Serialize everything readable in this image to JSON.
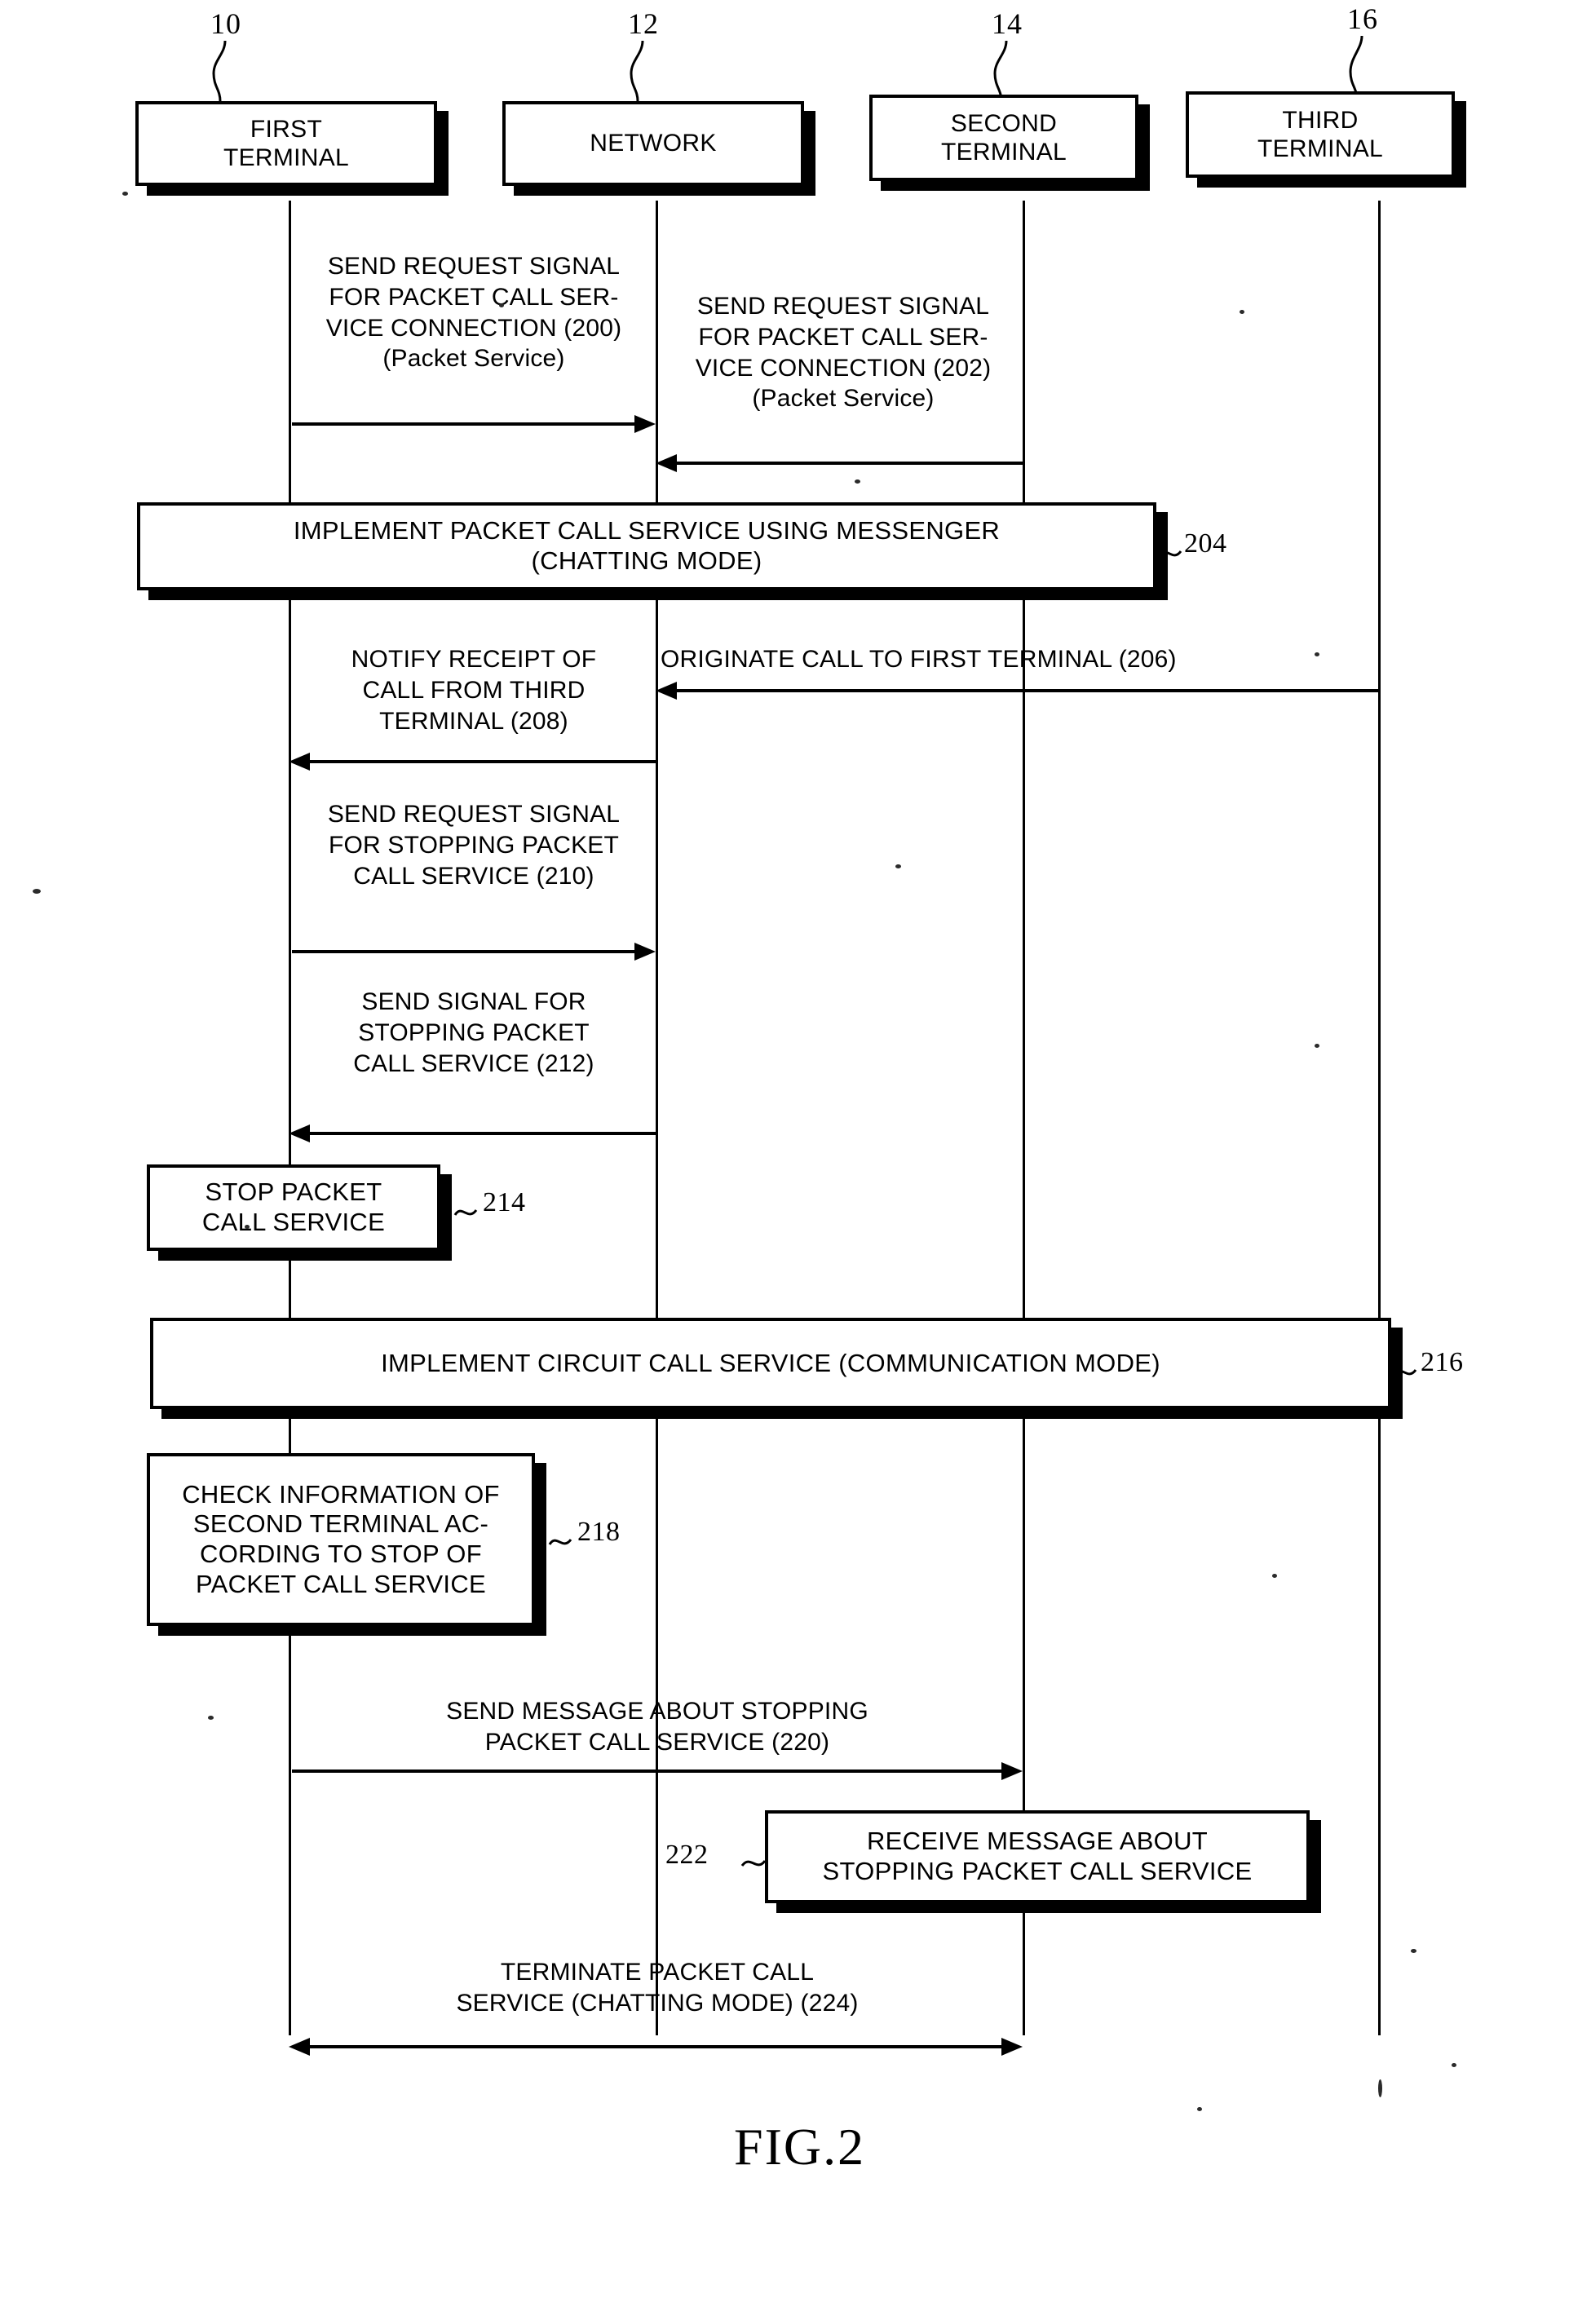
{
  "figure": {
    "caption": "FIG.2",
    "type": "sequence-diagram"
  },
  "participants": [
    {
      "ref": "10",
      "label_line1": "FIRST",
      "label_line2": "TERMINAL",
      "name": "first-terminal"
    },
    {
      "ref": "12",
      "label_line1": "NETWORK",
      "label_line2": "",
      "name": "network"
    },
    {
      "ref": "14",
      "label_line1": "SECOND",
      "label_line2": "TERMINAL",
      "name": "second-terminal"
    },
    {
      "ref": "16",
      "label_line1": "THIRD",
      "label_line2": "TERMINAL",
      "name": "third-terminal"
    }
  ],
  "messages": [
    {
      "id": "200",
      "text": "SEND REQUEST SIGNAL\nFOR PACKET CALL SER-\nVICE CONNECTION (200)\n(Packet Service)",
      "from": "first-terminal",
      "to": "network",
      "direction": "right"
    },
    {
      "id": "202",
      "text": "SEND REQUEST SIGNAL\nFOR PACKET CALL SER-\nVICE CONNECTION (202)\n(Packet Service)",
      "from": "second-terminal",
      "to": "network",
      "direction": "left"
    },
    {
      "id": "206",
      "text": "ORIGINATE CALL TO FIRST TERMINAL (206)",
      "from": "third-terminal",
      "to": "network",
      "direction": "left"
    },
    {
      "id": "208",
      "text": "NOTIFY RECEIPT OF\nCALL FROM THIRD\nTERMINAL (208)",
      "from": "network",
      "to": "first-terminal",
      "direction": "left"
    },
    {
      "id": "210",
      "text": "SEND REQUEST SIGNAL\nFOR STOPPING PACKET\nCALL SERVICE (210)",
      "from": "first-terminal",
      "to": "network",
      "direction": "right"
    },
    {
      "id": "212",
      "text": "SEND SIGNAL FOR\nSTOPPING PACKET\nCALL SERVICE (212)",
      "from": "network",
      "to": "first-terminal",
      "direction": "left"
    },
    {
      "id": "220",
      "text": "SEND MESSAGE ABOUT STOPPING\nPACKET CALL SERVICE (220)",
      "from": "first-terminal",
      "to": "second-terminal",
      "direction": "right"
    },
    {
      "id": "224",
      "text": "TERMINATE PACKET CALL\nSERVICE (CHATTING MODE) (224)",
      "from": "first-terminal",
      "to": "second-terminal",
      "direction": "both"
    }
  ],
  "process_blocks": [
    {
      "ref": "204",
      "line1": "IMPLEMENT PACKET CALL SERVICE USING MESSENGER",
      "line2": "(CHATTING MODE)",
      "line3": "",
      "line4": "",
      "name": "implement-packet-call-service-block"
    },
    {
      "ref": "214",
      "line1": "STOP PACKET",
      "line2": "CALL SERVICE",
      "line3": "",
      "line4": "",
      "name": "stop-packet-call-service-block"
    },
    {
      "ref": "216",
      "line1": "IMPLEMENT CIRCUIT CALL SERVICE (COMMUNICATION MODE)",
      "line2": "",
      "line3": "",
      "line4": "",
      "name": "implement-circuit-call-service-block"
    },
    {
      "ref": "218",
      "line1": "CHECK INFORMATION OF",
      "line2": "SECOND TERMINAL AC-",
      "line3": "CORDING TO STOP OF",
      "line4": "PACKET CALL SERVICE",
      "name": "check-information-block"
    },
    {
      "ref": "222",
      "line1": "RECEIVE MESSAGE ABOUT",
      "line2": "STOPPING PACKET CALL SERVICE",
      "line3": "",
      "line4": "",
      "name": "receive-message-block"
    }
  ],
  "side_refs": {
    "r204": "~204",
    "r214": "~ 214",
    "r216": "~216",
    "r218": "~ 218",
    "r222": "222~"
  },
  "colors": {
    "ink": "#000000",
    "paper": "#ffffff"
  }
}
